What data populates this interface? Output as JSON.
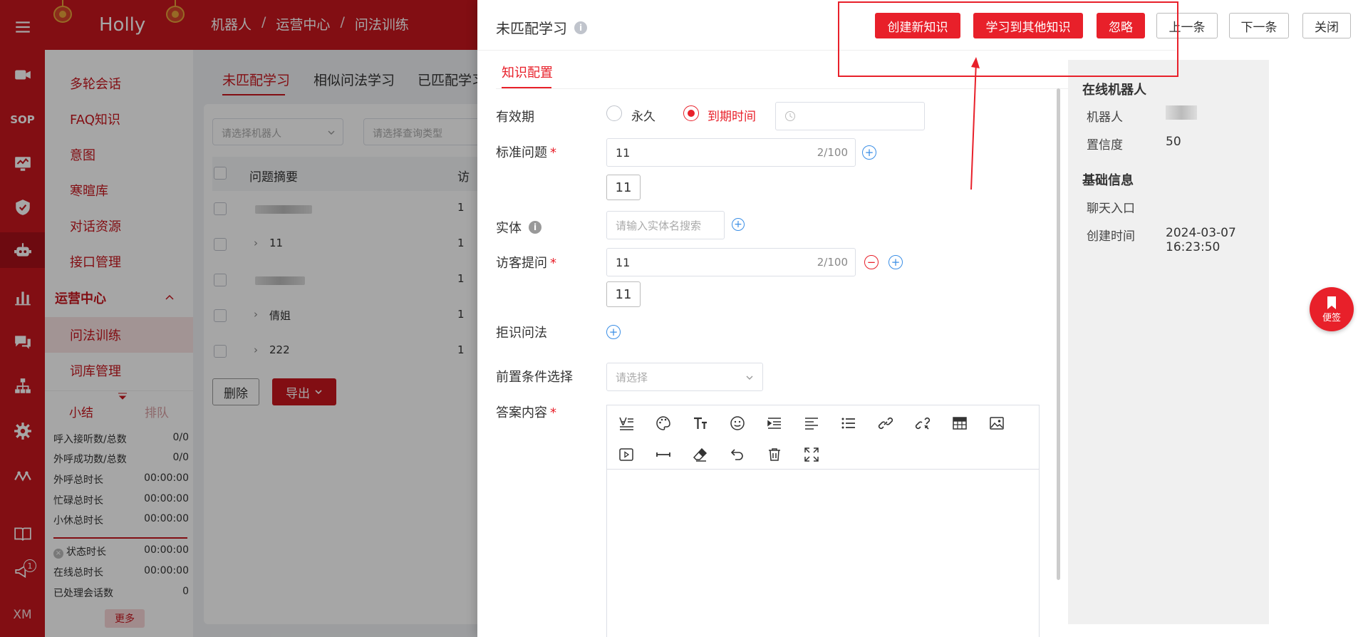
{
  "app": {
    "brand": "Holly"
  },
  "breadcrumb": [
    "机器人",
    "运营中心",
    "问法训练"
  ],
  "rail": {
    "sop_label": "SOP",
    "xm_label": "XM",
    "badge": "1"
  },
  "sidebar": {
    "items": [
      "多轮会话",
      "FAQ知识",
      "意图",
      "寒暄库",
      "对话资源",
      "接口管理"
    ],
    "group": "运营中心",
    "sub_items": [
      "问法训练",
      "词库管理"
    ]
  },
  "stats": {
    "tab_active": "小结",
    "tab_inactive": "排队",
    "rows": [
      {
        "label": "呼入接听数/总数",
        "value": "0/0"
      },
      {
        "label": "外呼成功数/总数",
        "value": "0/0"
      },
      {
        "label": "外呼总时长",
        "value": "00:00:00"
      },
      {
        "label": "忙碌总时长",
        "value": "00:00:00"
      },
      {
        "label": "小休总时长",
        "value": "00:00:00"
      }
    ],
    "rows2": [
      {
        "label": "状态时长",
        "value": "00:00:00"
      },
      {
        "label": "在线总时长",
        "value": "00:00:00"
      },
      {
        "label": "已处理会话数",
        "value": "0"
      }
    ],
    "more": "更多"
  },
  "main": {
    "tabs": [
      "未匹配学习",
      "相似问法学习",
      "已匹配学习"
    ],
    "filter_robot_placeholder": "请选择机器人",
    "filter_type_placeholder": "请选择查询类型",
    "col_summary": "问题摘要",
    "col_visits": "访",
    "rows": [
      {
        "text": "",
        "count": "1"
      },
      {
        "text": "11",
        "count": "1"
      },
      {
        "text": "",
        "count": "1"
      },
      {
        "text": "倩姐",
        "count": "1"
      },
      {
        "text": "222",
        "count": "1"
      }
    ],
    "delete_btn": "删除",
    "export_btn": "导出"
  },
  "drawer": {
    "title": "未匹配学习",
    "buttons": {
      "create": "创建新知识",
      "learn_other": "学习到其他知识",
      "ignore": "忽略",
      "prev": "上一条",
      "next": "下一条",
      "close": "关闭"
    },
    "tab": "知识配置",
    "form": {
      "validity_label": "有效期",
      "validity_forever": "永久",
      "validity_until": "到期时间",
      "std_q_label": "标准问题",
      "std_q_value": "11",
      "std_q_count": "2/100",
      "std_q_tag": "11",
      "entity_label": "实体",
      "entity_placeholder": "请输入实体名搜索",
      "visitor_q_label": "访客提问",
      "visitor_q_value": "11",
      "visitor_q_count": "2/100",
      "visitor_q_tag": "11",
      "reject_label": "拒识问法",
      "precond_label": "前置条件选择",
      "precond_placeholder": "请选择",
      "answer_label": "答案内容"
    },
    "info": {
      "section1": "在线机器人",
      "robot_key": "机器人",
      "confidence_key": "置信度",
      "confidence_val": "50",
      "section2": "基础信息",
      "chat_entry_key": "聊天入口",
      "created_key": "创建时间",
      "created_val": "2024-03-07 16:23:50"
    },
    "note_btn": "便签"
  },
  "colors": {
    "brand": "#c8161e",
    "accent": "#e8202a",
    "link": "#3a8ee6"
  }
}
